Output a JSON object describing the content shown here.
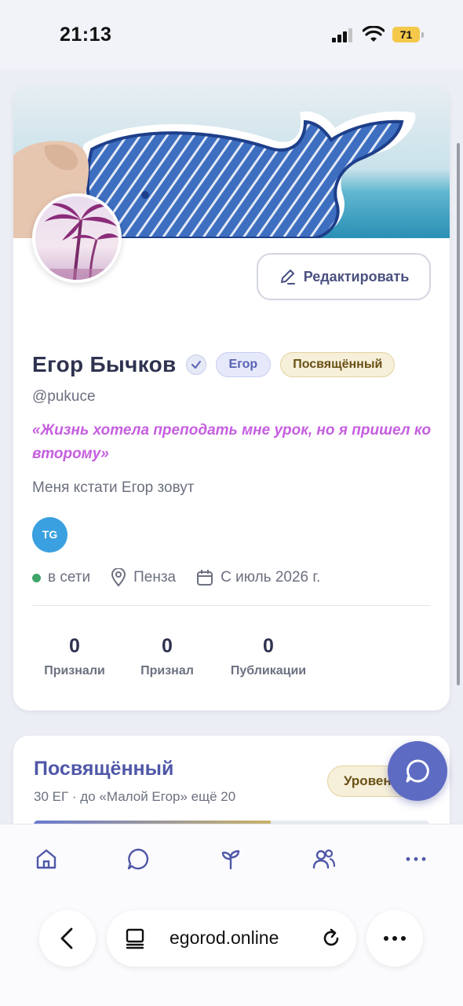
{
  "status": {
    "time": "21:13",
    "battery": "71"
  },
  "profile": {
    "edit_label": "Редактировать",
    "name": "Егор Бычков",
    "badge_primary": "Егор",
    "badge_rank": "Посвящённый",
    "handle": "@pukuce",
    "quote": "«Жизнь хотела преподать мне урок, но я пришел ко второму»",
    "bio": "Меня кстати Егор зовут",
    "social_tg": "TG",
    "online": "в сети",
    "city": "Пенза",
    "since": "С июль 2026 г.",
    "stats": [
      {
        "value": "0",
        "label": "Признали"
      },
      {
        "value": "0",
        "label": "Признал"
      },
      {
        "value": "0",
        "label": "Публикации"
      }
    ]
  },
  "level": {
    "title": "Посвящённый",
    "subtitle": "30 ЕГ · до «Малой Егор» ещё 20",
    "badge": "Уровень",
    "progress_fraction": 0.6
  },
  "browser": {
    "url": "egorod.online"
  },
  "nav_icons": [
    "home-icon",
    "chat-icon",
    "sprout-icon",
    "people-icon",
    "more-icon"
  ],
  "colors": {
    "accent": "#5e6bc3",
    "quote": "#c65ee0",
    "online": "#3fa46a",
    "tg": "#3aa0e0"
  }
}
